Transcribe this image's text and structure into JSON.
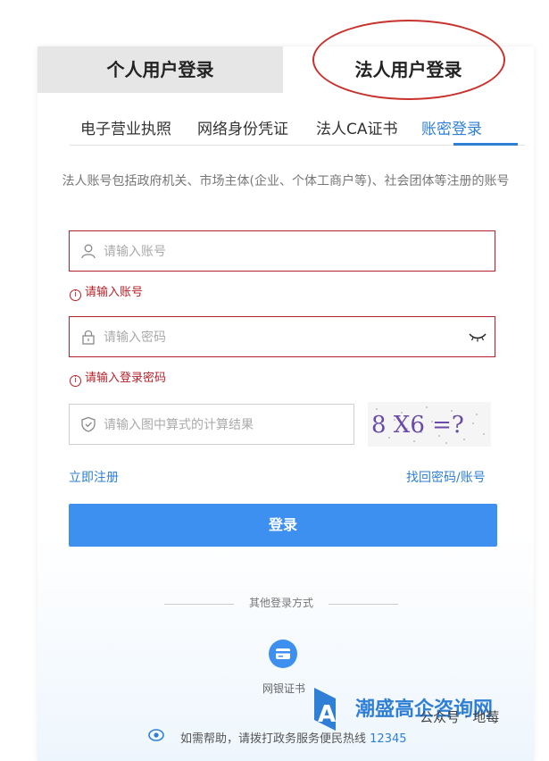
{
  "top_tabs": {
    "personal": "个人用户登录",
    "corporate": "法人用户登录"
  },
  "sub_tabs": [
    {
      "label": "电子营业执照"
    },
    {
      "label": "网络身份凭证"
    },
    {
      "label": "法人CA证书"
    },
    {
      "label": "账密登录"
    }
  ],
  "description": "法人账号包括政府机关、市场主体(企业、个体工商户等)、社会团体等注册的账号",
  "account": {
    "placeholder": "请输入账号",
    "error": "请输入账号"
  },
  "password": {
    "placeholder": "请输入密码",
    "error": "请输入登录密码"
  },
  "captcha": {
    "placeholder": "请输入图中算式的计算结果",
    "expression": "8 X6 =?"
  },
  "links": {
    "register": "立即注册",
    "recover": "找回密码/账号"
  },
  "login_button": "登录",
  "other_methods": {
    "title": "其他登录方式",
    "bank_cert": "网银证书"
  },
  "help": {
    "text": "如需帮助，请拨打政务服务便民热线",
    "hotline": "12345"
  },
  "watermark": {
    "site": "潮盛高企咨询网",
    "social": "公众号 · 地莓"
  },
  "colors": {
    "accent": "#3d8ff0",
    "error": "#b5212a",
    "annotation": "#c8322c"
  }
}
